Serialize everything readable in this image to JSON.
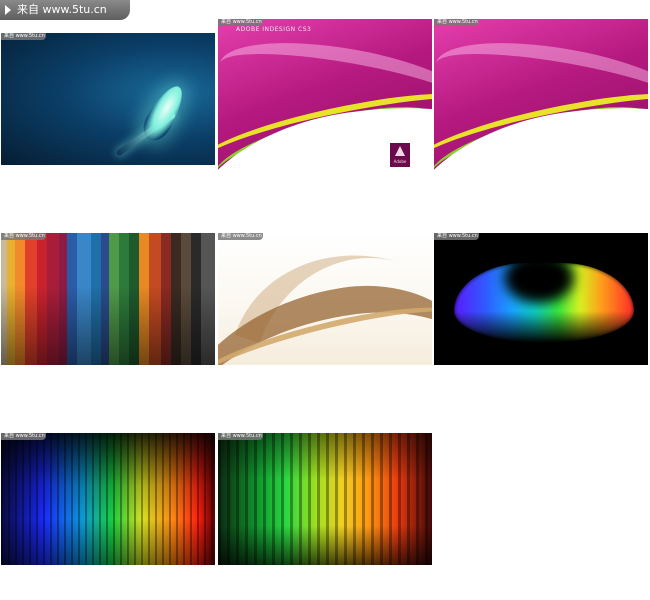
{
  "watermark": {
    "text": "来自 www.5tu.cn",
    "mini_text": "来自 www.5tu.cn"
  },
  "tiles": [
    {
      "id": "t1",
      "subject": "glowing-feather"
    },
    {
      "id": "t2",
      "subject": "adobe-indesign-cs3-wave",
      "overlay_text": "ADOBE INDESIGN CS3",
      "logo_text": "Adobe"
    },
    {
      "id": "t3",
      "subject": "adobe-indesign-cs3-wave",
      "logo_text": ""
    },
    {
      "id": "t4",
      "subject": "color-stripes"
    },
    {
      "id": "t5",
      "subject": "golden-waves"
    },
    {
      "id": "t6",
      "subject": "spectrum-glow"
    },
    {
      "id": "t7",
      "subject": "spectrum-stripes-blue-red"
    },
    {
      "id": "t8",
      "subject": "spectrum-stripes-green-red"
    }
  ],
  "colors": {
    "watermark_bg": "#6e6e6e",
    "page_bg": "#ffffff"
  }
}
